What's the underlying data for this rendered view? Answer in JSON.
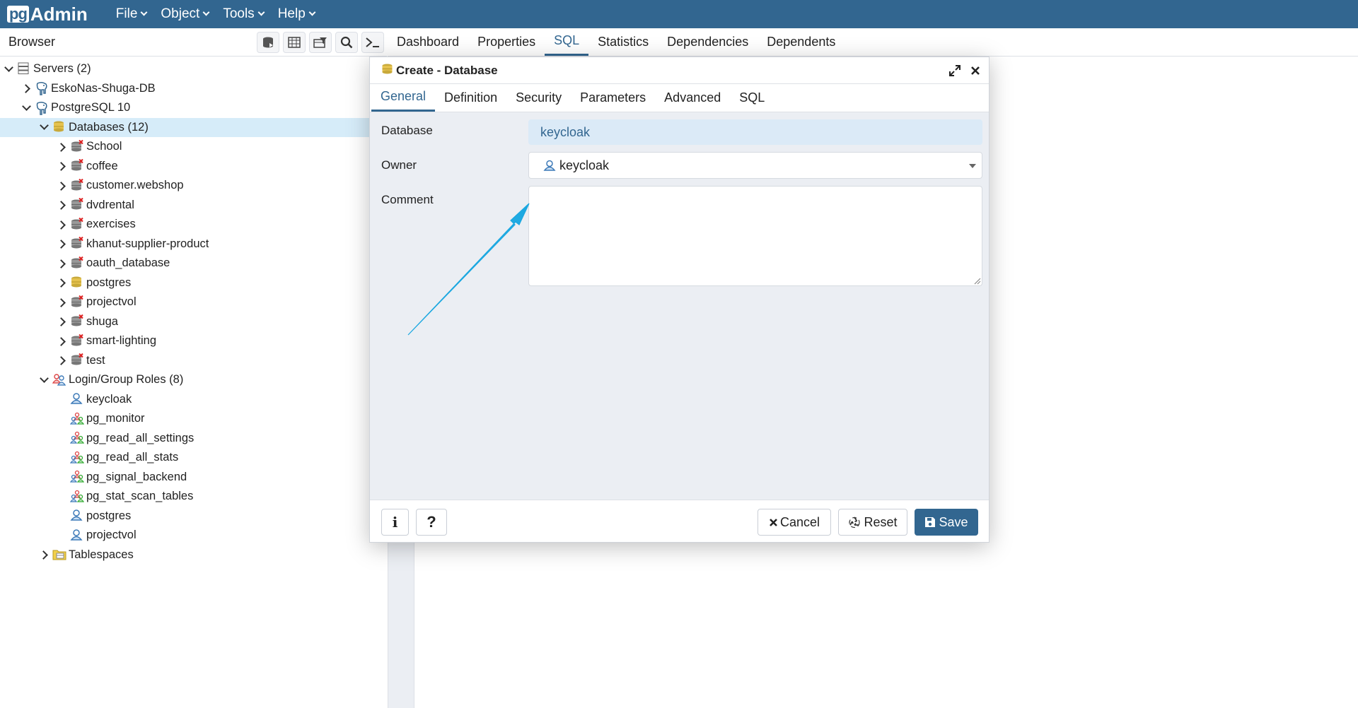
{
  "app": {
    "brand_pg": "pg",
    "brand_admin": "Admin"
  },
  "menu": [
    "File",
    "Object",
    "Tools",
    "Help"
  ],
  "browser": {
    "title": "Browser",
    "tree": [
      {
        "label": "Servers (2)",
        "level": 0,
        "toggle": "open",
        "icon": "servers-icon"
      },
      {
        "label": "EskoNas-Shuga-DB",
        "level": 1,
        "toggle": "closed",
        "icon": "elephant-icon"
      },
      {
        "label": "PostgreSQL 10",
        "level": 1,
        "toggle": "open",
        "icon": "elephant-icon"
      },
      {
        "label": "Databases (12)",
        "level": 2,
        "toggle": "open",
        "icon": "databases-icon",
        "selected": true
      },
      {
        "label": "School",
        "level": 3,
        "toggle": "closed",
        "icon": "database-disconnected-icon"
      },
      {
        "label": "coffee",
        "level": 3,
        "toggle": "closed",
        "icon": "database-disconnected-icon"
      },
      {
        "label": "customer.webshop",
        "level": 3,
        "toggle": "closed",
        "icon": "database-disconnected-icon"
      },
      {
        "label": "dvdrental",
        "level": 3,
        "toggle": "closed",
        "icon": "database-disconnected-icon"
      },
      {
        "label": "exercises",
        "level": 3,
        "toggle": "closed",
        "icon": "database-disconnected-icon"
      },
      {
        "label": "khanut-supplier-product",
        "level": 3,
        "toggle": "closed",
        "icon": "database-disconnected-icon"
      },
      {
        "label": "oauth_database",
        "level": 3,
        "toggle": "closed",
        "icon": "database-disconnected-icon"
      },
      {
        "label": "postgres",
        "level": 3,
        "toggle": "closed",
        "icon": "database-connected-icon"
      },
      {
        "label": "projectvol",
        "level": 3,
        "toggle": "closed",
        "icon": "database-disconnected-icon"
      },
      {
        "label": "shuga",
        "level": 3,
        "toggle": "closed",
        "icon": "database-disconnected-icon"
      },
      {
        "label": "smart-lighting",
        "level": 3,
        "toggle": "closed",
        "icon": "database-disconnected-icon"
      },
      {
        "label": "test",
        "level": 3,
        "toggle": "closed",
        "icon": "database-disconnected-icon"
      },
      {
        "label": "Login/Group Roles (8)",
        "level": 2,
        "toggle": "open",
        "icon": "roles-icon"
      },
      {
        "label": "keycloak",
        "level": 3,
        "toggle": "none",
        "icon": "user-icon"
      },
      {
        "label": "pg_monitor",
        "level": 3,
        "toggle": "none",
        "icon": "group-role-icon"
      },
      {
        "label": "pg_read_all_settings",
        "level": 3,
        "toggle": "none",
        "icon": "group-role-icon"
      },
      {
        "label": "pg_read_all_stats",
        "level": 3,
        "toggle": "none",
        "icon": "group-role-icon"
      },
      {
        "label": "pg_signal_backend",
        "level": 3,
        "toggle": "none",
        "icon": "group-role-icon"
      },
      {
        "label": "pg_stat_scan_tables",
        "level": 3,
        "toggle": "none",
        "icon": "group-role-icon"
      },
      {
        "label": "postgres",
        "level": 3,
        "toggle": "none",
        "icon": "user-icon"
      },
      {
        "label": "projectvol",
        "level": 3,
        "toggle": "none",
        "icon": "user-icon"
      },
      {
        "label": "Tablespaces",
        "level": 2,
        "toggle": "closed",
        "icon": "tablespaces-icon"
      }
    ]
  },
  "main_tabs": [
    {
      "label": "Dashboard",
      "active": false
    },
    {
      "label": "Properties",
      "active": false
    },
    {
      "label": "SQL",
      "active": true
    },
    {
      "label": "Statistics",
      "active": false
    },
    {
      "label": "Dependencies",
      "active": false
    },
    {
      "label": "Dependents",
      "active": false
    }
  ],
  "dialog": {
    "title": "Create - Database",
    "tabs": [
      {
        "label": "General",
        "active": true
      },
      {
        "label": "Definition",
        "active": false
      },
      {
        "label": "Security",
        "active": false
      },
      {
        "label": "Parameters",
        "active": false
      },
      {
        "label": "Advanced",
        "active": false
      },
      {
        "label": "SQL",
        "active": false
      }
    ],
    "fields": {
      "database_label": "Database",
      "database_value": "keycloak",
      "owner_label": "Owner",
      "owner_value": "keycloak",
      "comment_label": "Comment",
      "comment_value": ""
    },
    "buttons": {
      "info": "i",
      "help": "?",
      "cancel": "Cancel",
      "reset": "Reset",
      "save": "Save"
    }
  },
  "colors": {
    "navbar": "#326690",
    "accent": "#326690",
    "arrow": "#1aa7e0",
    "selected_row": "#d6ecf9"
  }
}
